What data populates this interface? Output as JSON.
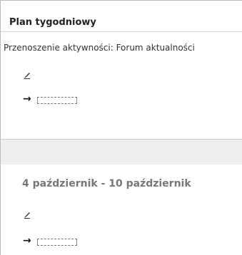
{
  "block": {
    "title": "Plan tygodniowy"
  },
  "status": {
    "moving_text": "Przenoszenie aktywności: Forum aktualności"
  },
  "week": {
    "heading": "4 październik - 10 październik"
  },
  "icons": {
    "edit": "edit-icon",
    "move_arrow": "→"
  },
  "colors": {
    "separator": "#eeeeee",
    "week_heading": "#777777"
  }
}
